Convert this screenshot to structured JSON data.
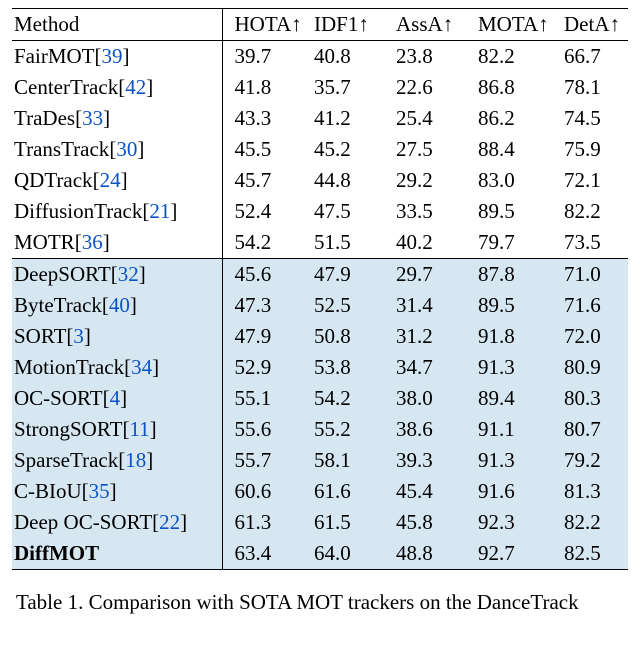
{
  "header": {
    "method": "Method",
    "metrics": [
      "HOTA↑",
      "IDF1↑",
      "AssA↑",
      "MOTA↑",
      "DetA↑"
    ]
  },
  "group1": [
    {
      "name": "FairMOT",
      "cite": "39",
      "vals": [
        "39.7",
        "40.8",
        "23.8",
        "82.2",
        "66.7"
      ]
    },
    {
      "name": "CenterTrack",
      "cite": "42",
      "vals": [
        "41.8",
        "35.7",
        "22.6",
        "86.8",
        "78.1"
      ]
    },
    {
      "name": "TraDes",
      "cite": "33",
      "vals": [
        "43.3",
        "41.2",
        "25.4",
        "86.2",
        "74.5"
      ]
    },
    {
      "name": "TransTrack",
      "cite": "30",
      "vals": [
        "45.5",
        "45.2",
        "27.5",
        "88.4",
        "75.9"
      ]
    },
    {
      "name": "QDTrack",
      "cite": "24",
      "vals": [
        "45.7",
        "44.8",
        "29.2",
        "83.0",
        "72.1"
      ]
    },
    {
      "name": "DiffusionTrack",
      "cite": "21",
      "vals": [
        "52.4",
        "47.5",
        "33.5",
        "89.5",
        "82.2"
      ]
    },
    {
      "name": "MOTR",
      "cite": "36",
      "vals": [
        "54.2",
        "51.5",
        "40.2",
        "79.7",
        "73.5"
      ]
    }
  ],
  "group2": [
    {
      "name": "DeepSORT",
      "cite": "32",
      "vals": [
        "45.6",
        "47.9",
        "29.7",
        "87.8",
        "71.0"
      ]
    },
    {
      "name": "ByteTrack",
      "cite": "40",
      "vals": [
        "47.3",
        "52.5",
        "31.4",
        "89.5",
        "71.6"
      ]
    },
    {
      "name": "SORT",
      "cite": "3",
      "vals": [
        "47.9",
        "50.8",
        "31.2",
        "91.8",
        "72.0"
      ]
    },
    {
      "name": "MotionTrack",
      "cite": "34",
      "vals": [
        "52.9",
        "53.8",
        "34.7",
        "91.3",
        "80.9"
      ]
    },
    {
      "name": "OC-SORT",
      "cite": "4",
      "vals": [
        "55.1",
        "54.2",
        "38.0",
        "89.4",
        "80.3"
      ]
    },
    {
      "name": "StrongSORT",
      "cite": "11",
      "vals": [
        "55.6",
        "55.2",
        "38.6",
        "91.1",
        "80.7"
      ]
    },
    {
      "name": "SparseTrack",
      "cite": "18",
      "vals": [
        "55.7",
        "58.1",
        "39.3",
        "91.3",
        "79.2"
      ]
    },
    {
      "name": "C-BIoU",
      "cite": "35",
      "vals": [
        "60.6",
        "61.6",
        "45.4",
        "91.6",
        "81.3"
      ]
    },
    {
      "name": "Deep OC-SORT",
      "cite": "22",
      "vals": [
        "61.3",
        "61.5",
        "45.8",
        "92.3",
        "82.2"
      ]
    },
    {
      "name": "DiffMOT",
      "cite": "",
      "bold": true,
      "vals": [
        "63.4",
        "64.0",
        "48.8",
        "92.7",
        "82.5"
      ]
    }
  ],
  "caption": "Table 1. Comparison with SOTA MOT trackers on the DanceTrack"
}
